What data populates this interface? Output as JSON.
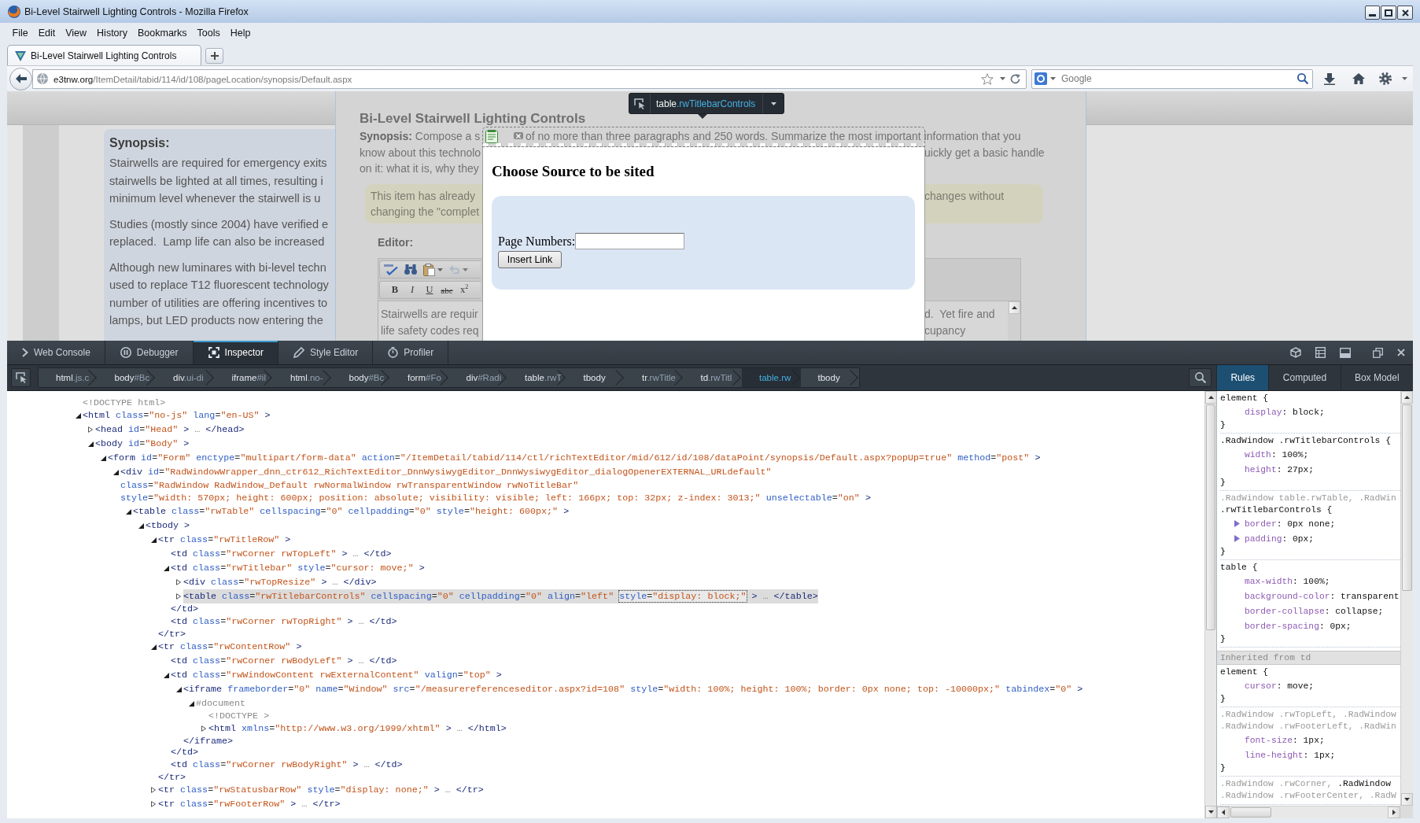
{
  "window": {
    "title": "Bi-Level Stairwell Lighting Controls - Mozilla Firefox"
  },
  "menu": [
    "File",
    "Edit",
    "View",
    "History",
    "Bookmarks",
    "Tools",
    "Help"
  ],
  "tabs": [
    {
      "label": "Bi-Level Stairwell Lighting Controls",
      "selected": true
    }
  ],
  "address_bar": {
    "url": "e3tnw.org/ItemDetail/tabid/114/id/108/pageLocation/synopsis/Default.aspx"
  },
  "search": {
    "placeholder": "Google"
  },
  "page": {
    "side_panel": {
      "heading": "Synopsis:",
      "paragraphs": [
        [
          "Stairwells are required for emergency exits",
          "stairwells be lighted at all times, resulting i",
          "minimum level whenever the stairwell is u"
        ],
        [
          "Studies (mostly since 2004) have verified e",
          "replaced.  Lamp life can also be increased"
        ],
        [
          "Although new luminares with bi-level techn",
          "used to replace T12 fluorescent technology",
          "number of utilities are offering incentives to",
          "lamps, but LED products now entering the"
        ]
      ]
    },
    "title": "Bi-Level Stairwell Lighting Controls",
    "synopsis_lines": [
      {
        "left": "**Synopsis:** Compose a s",
        "middle": "of no more than three paragraphs and 250 words. Summarize the most important information that you"
      },
      {
        "left": "know about this technolo",
        "right": "uickly get a basic handle"
      },
      {
        "left": "on it: what it is, why they"
      }
    ],
    "notice_lines": [
      {
        "left": "This item has already",
        "right": "changes without"
      },
      {
        "left": "changing the \"complet"
      }
    ],
    "editor": {
      "label": "Editor:",
      "tools": [
        {
          "kind": "spellcheck",
          "disabled": false
        },
        {
          "kind": "find",
          "disabled": false
        },
        {
          "kind": "paste",
          "disabled": false
        },
        {
          "kind": "undo",
          "disabled": true
        }
      ],
      "format_buttons": [
        {
          "kind": "bold",
          "label": "B"
        },
        {
          "kind": "italic",
          "label": "I"
        },
        {
          "kind": "underline",
          "label": "U"
        },
        {
          "kind": "strike",
          "label": "abc"
        },
        {
          "kind": "superscript",
          "label": "x$^{2}$"
        }
      ],
      "text_lines": [
        {
          "left": "Stairwells are requir",
          "right": "d.  Yet fire and"
        },
        {
          "left": "life safety codes req",
          "right": "cupancy"
        }
      ]
    }
  },
  "dialog": {
    "title": "Choose Source to be sited",
    "field_label": "Page Numbers:",
    "button": "Insert Link"
  },
  "node_infobar": {
    "label": "table.rwTitlebarControls"
  },
  "devtools": {
    "tools": [
      {
        "kind": "console",
        "label": "Web Console",
        "selected": false
      },
      {
        "kind": "debugger",
        "label": "Debugger",
        "selected": false
      },
      {
        "kind": "inspector",
        "label": "Inspector",
        "selected": true
      },
      {
        "kind": "style-editor",
        "label": "Style Editor",
        "selected": false
      },
      {
        "kind": "profiler",
        "label": "Profiler",
        "selected": false
      }
    ],
    "breadcrumbs": [
      {
        "label": "html.js.c",
        "selected": false
      },
      {
        "label": "body#Bc",
        "selected": false
      },
      {
        "label": "div.ui-di",
        "selected": false
      },
      {
        "label": "iframe#il",
        "selected": false
      },
      {
        "label": "html.no-",
        "selected": false
      },
      {
        "label": "body#Bc",
        "selected": false
      },
      {
        "label": "form#Fo",
        "selected": false
      },
      {
        "label": "div#Radi",
        "selected": false
      },
      {
        "label": "table.rwT",
        "selected": false
      },
      {
        "label": "tbody",
        "selected": false
      },
      {
        "label": "tr.rwTitle",
        "selected": false
      },
      {
        "label": "td.rwTitl",
        "selected": false
      },
      {
        "label": "table.rw",
        "selected": true
      },
      {
        "label": "tbody",
        "selected": false
      }
    ],
    "sidebar_tabs": [
      {
        "label": "Rules",
        "selected": true
      },
      {
        "label": "Computed",
        "selected": false
      },
      {
        "label": "Box Model",
        "selected": false
      }
    ],
    "markup": [
      {
        "kind": "doctype",
        "text": "<!DOCTYPE html>",
        "selected": false
      },
      {
        "kind": "branch",
        "text": "<html class=\"no-js\" lang=\"en-US\" >",
        "expanded": true,
        "selected": false,
        "children": [
          {
            "kind": "branch",
            "text": "<head id=\"Head\" > … </head>",
            "expanded": false,
            "selected": false
          },
          {
            "kind": "branch",
            "text": "<body id=\"Body\" >",
            "expanded": true,
            "selected": false,
            "children": [
              {
                "kind": "branch",
                "text": "<form id=\"Form\" enctype=\"multipart/form-data\" action=\"/ItemDetail/tabid/114/ctl/richTextEditor/mid/612/id/108/dataPoint/synopsis/Default.aspx?popUp=true\" method=\"post\" >",
                "expanded": true,
                "selected": false,
                "children": [
                  {
                    "kind": "branch",
                    "text": "<div id=\"RadWindowWrapper_dnn_ctr612_RichTextEditor_DnnWysiwygEditor_DnnWysiwygEditor_dialogOpenerEXTERNAL_URLdefault\"",
                    "more_lines": [
                      "class=\"RadWindow RadWindow_Default rwNormalWindow rwTransparentWindow rwNoTitleBar\"",
                      "style=\"width: 570px; height: 600px; position: absolute; visibility: visible; left: 166px; top: 32px; z-index: 3013;\" unselectable=\"on\" >"
                    ],
                    "expanded": true,
                    "selected": false,
                    "children": [
                      {
                        "kind": "branch",
                        "text": "<table class=\"rwTable\" cellspacing=\"0\" cellpadding=\"0\" style=\"height: 600px;\" >",
                        "expanded": true,
                        "selected": false,
                        "children": [
                          {
                            "kind": "branch",
                            "text": "<tbody >",
                            "expanded": true,
                            "selected": false,
                            "children": [
                              {
                                "kind": "branch",
                                "text": "<tr class=\"rwTitleRow\" >",
                                "expanded": true,
                                "selected": false,
                                "close": "</tr>",
                                "children": [
                                  {
                                    "kind": "leaf",
                                    "text": "<td class=\"rwCorner rwTopLeft\" > … </td>",
                                    "selected": false
                                  },
                                  {
                                    "kind": "branch",
                                    "text": "<td class=\"rwTitlebar\" style=\"cursor: move;\" >",
                                    "expanded": true,
                                    "selected": false,
                                    "close": "</td>",
                                    "children": [
                                      {
                                        "kind": "branch",
                                        "text": "<div class=\"rwTopResize\" > … </div>",
                                        "expanded": false,
                                        "selected": false
                                      },
                                      {
                                        "kind": "branch",
                                        "text": [
                                          {
                                            "text": "<table class=\"rwTitlebarControls\" cellspacing=\"0\" cellpadding=\"0\" align=\"left\" ",
                                            "focused": false
                                          },
                                          {
                                            "text": "style=\"display: block;\"",
                                            "focused": true
                                          },
                                          {
                                            "text": " > … </table>",
                                            "focused": false
                                          }
                                        ],
                                        "expanded": false,
                                        "selected": true
                                      }
                                    ]
                                  },
                                  {
                                    "kind": "leaf",
                                    "text": "<td class=\"rwCorner rwTopRight\" > … </td>",
                                    "selected": false
                                  }
                                ]
                              },
                              {
                                "kind": "branch",
                                "text": "<tr class=\"rwContentRow\" >",
                                "expanded": true,
                                "selected": false,
                                "close": "</tr>",
                                "children": [
                                  {
                                    "kind": "leaf",
                                    "text": "<td class=\"rwCorner rwBodyLeft\" > … </td>",
                                    "selected": false
                                  },
                                  {
                                    "kind": "branch",
                                    "text": "<td class=\"rwWindowContent rwExternalContent\" valign=\"top\" >",
                                    "expanded": true,
                                    "selected": false,
                                    "close": "</td>",
                                    "children": [
                                      {
                                        "kind": "branch",
                                        "text": "<iframe frameborder=\"0\" name=\"Window\" src=\"/measurereferenceseditor.aspx?id=108\" style=\"width: 100%; height: 100%; border: 0px none; top: -10000px;\" tabindex=\"0\" >",
                                        "expanded": true,
                                        "selected": false,
                                        "close": "</iframe>",
                                        "children": [
                                          {
                                            "kind": "document",
                                            "text": "#document",
                                            "expanded": true,
                                            "selected": false,
                                            "children": [
                                              {
                                                "kind": "doctype",
                                                "text": "<!DOCTYPE >",
                                                "selected": false
                                              },
                                              {
                                                "kind": "branch",
                                                "text": "<html xmlns=\"http://www.w3.org/1999/xhtml\" > … </html>",
                                                "expanded": false,
                                                "selected": false
                                              }
                                            ]
                                          }
                                        ]
                                      }
                                    ]
                                  },
                                  {
                                    "kind": "leaf",
                                    "text": "<td class=\"rwCorner rwBodyRight\" > … </td>",
                                    "selected": false
                                  }
                                ]
                              },
                              {
                                "kind": "branch",
                                "text": "<tr class=\"rwStatusbarRow\" style=\"display: none;\" > … </tr>",
                                "expanded": false,
                                "selected": false
                              },
                              {
                                "kind": "branch",
                                "text": "<tr class=\"rwFooterRow\" > … </tr>",
                                "expanded": false,
                                "selected": false
                              }
                            ]
                          }
                        ]
                      }
                    ]
                  }
                ]
              }
            ]
          }
        ]
      }
    ],
    "rules": [
      {
        "kind": "rule",
        "selector": [
          [
            {
              "text": "element {",
              "matched": true
            }
          ]
        ],
        "declarations": [
          {
            "kind": "plain",
            "text": "display: block;"
          }
        ],
        "close": "}"
      },
      {
        "kind": "rule",
        "selector": [
          [
            {
              "text": ".RadWindow .rwTitlebarControls {",
              "matched": true
            }
          ]
        ],
        "declarations": [
          {
            "kind": "plain",
            "text": "width: 100%;"
          },
          {
            "kind": "plain",
            "text": "height: 27px;"
          }
        ],
        "close": "}"
      },
      {
        "kind": "rule",
        "selector": [
          [
            {
              "text": ".RadWindow table.rwTable, .RadWin",
              "matched": false
            }
          ],
          [
            {
              "text": ".rwTitlebarControls {",
              "matched": true
            }
          ]
        ],
        "declarations": [
          {
            "kind": "shorthand",
            "expanded": false,
            "text": "border: 0px none;"
          },
          {
            "kind": "shorthand",
            "expanded": false,
            "text": "padding: 0px;"
          }
        ],
        "close": "}"
      },
      {
        "kind": "rule",
        "selector": [
          [
            {
              "text": "table {",
              "matched": true
            }
          ]
        ],
        "declarations": [
          {
            "kind": "plain",
            "text": "max-width: 100%;"
          },
          {
            "kind": "plain",
            "text": "background-color: transparent"
          },
          {
            "kind": "plain",
            "text": "border-collapse: collapse;"
          },
          {
            "kind": "plain",
            "text": "border-spacing: 0px;"
          }
        ],
        "close": "}"
      },
      {
        "kind": "header",
        "text": "Inherited from td"
      },
      {
        "kind": "rule",
        "selector": [
          [
            {
              "text": "element {",
              "matched": true
            }
          ]
        ],
        "declarations": [
          {
            "kind": "plain",
            "text": "cursor: move;"
          }
        ],
        "close": "}"
      },
      {
        "kind": "rule",
        "selector": [
          [
            {
              "text": ".RadWindow .rwTopLeft, .RadWindow",
              "matched": false
            }
          ],
          [
            {
              "text": ".RadWindow .rwFooterLeft, .RadWin",
              "matched": false
            }
          ]
        ],
        "declarations": [
          {
            "kind": "plain",
            "text": "font-size: 1px;"
          },
          {
            "kind": "plain",
            "text": "line-height: 1px;"
          }
        ],
        "close": "}"
      },
      {
        "kind": "rule",
        "selector": [
          [
            {
              "text": ".RadWindow .rwCorner, ",
              "matched": false
            },
            {
              "text": ".RadWindow",
              "matched": true
            }
          ],
          [
            {
              "text": ".RadWindow .rwFooterCenter, .RadW",
              "matched": false
            }
          ]
        ]
      }
    ]
  }
}
